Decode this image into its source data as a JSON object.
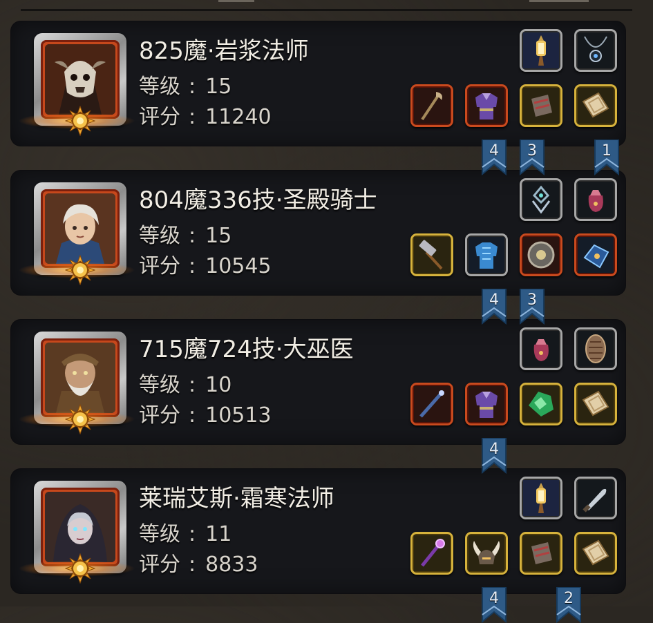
{
  "heroes": [
    {
      "name": "825魔·岩浆法师",
      "level_label": "等级",
      "level": "15",
      "score_label": "评分",
      "score": "11240",
      "top_items": [
        {
          "icon": "lantern-icon",
          "quality": "gray"
        },
        {
          "icon": "amulet-icon",
          "quality": "gray"
        }
      ],
      "bottom_items": [
        {
          "icon": "staff-icon",
          "quality": "red"
        },
        {
          "icon": "armor-icon",
          "quality": "red"
        },
        {
          "icon": "bracer-icon",
          "quality": "gold"
        },
        {
          "icon": "scroll-icon",
          "quality": "gold"
        }
      ],
      "ribbons": [
        "4",
        "3",
        "1"
      ]
    },
    {
      "name": "804魔336技·圣殿骑士",
      "level_label": "等级",
      "level": "15",
      "score_label": "评分",
      "score": "10545",
      "top_items": [
        {
          "icon": "emblem-icon",
          "quality": "gray"
        },
        {
          "icon": "pouch-icon",
          "quality": "gray"
        }
      ],
      "bottom_items": [
        {
          "icon": "hammer-icon",
          "quality": "gold"
        },
        {
          "icon": "chest-armor-icon",
          "quality": "gray"
        },
        {
          "icon": "shield-icon",
          "quality": "red"
        },
        {
          "icon": "gauntlet-icon",
          "quality": "red"
        }
      ],
      "ribbons": [
        "4",
        "3"
      ]
    },
    {
      "name": "715魔724技·大巫医",
      "level_label": "等级",
      "level": "10",
      "score_label": "评分",
      "score": "10513",
      "top_items": [
        {
          "icon": "pouch-icon",
          "quality": "gray"
        },
        {
          "icon": "tribal-shield-icon",
          "quality": "gray"
        }
      ],
      "bottom_items": [
        {
          "icon": "wand-icon",
          "quality": "red"
        },
        {
          "icon": "armor-icon",
          "quality": "red"
        },
        {
          "icon": "gem-icon",
          "quality": "gold"
        },
        {
          "icon": "scroll-icon",
          "quality": "gold"
        }
      ],
      "ribbons": [
        "4"
      ]
    },
    {
      "name": "莱瑞艾斯·霜寒法师",
      "level_label": "等级",
      "level": "11",
      "score_label": "评分",
      "score": "8833",
      "top_items": [
        {
          "icon": "lantern-icon",
          "quality": "gray"
        },
        {
          "icon": "dagger-icon",
          "quality": "gray"
        }
      ],
      "bottom_items": [
        {
          "icon": "scepter-icon",
          "quality": "gold"
        },
        {
          "icon": "horned-helm-icon",
          "quality": "gold"
        },
        {
          "icon": "bracer-icon",
          "quality": "gold"
        },
        {
          "icon": "scroll-icon",
          "quality": "gold"
        }
      ],
      "ribbons": [
        "4",
        "2"
      ]
    }
  ],
  "colors": {
    "panel": "#16171b",
    "portrait_frame": "#c6481c",
    "ribbon": "#2e5a86",
    "quality_red": "#c94a1e",
    "quality_gold": "#d6b23c",
    "quality_gray": "#a7a7a7"
  }
}
